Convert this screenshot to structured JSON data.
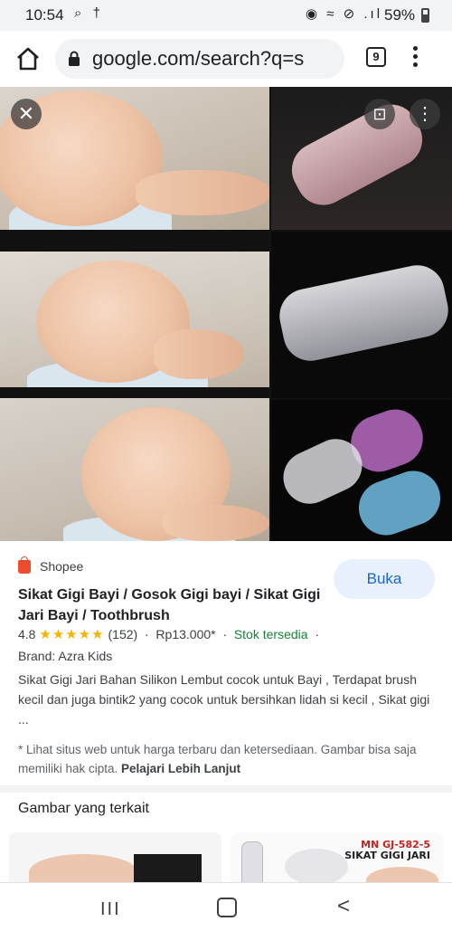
{
  "status_bar": {
    "time": "10:54",
    "left_icons": "⌕ †",
    "right_icons": "◉ ≈ ⊘ .ıl",
    "battery": "59%"
  },
  "browser": {
    "url": "google.com/search?q=s",
    "tab_count": "9"
  },
  "result": {
    "source": "Shopee",
    "open_button": "Buka",
    "title": "Sikat Gigi Bayi / Gosok Gigi bayi / Sikat Gigi Jari Bayi / Toothbrush",
    "rating": "4.8",
    "stars": "★★★★★",
    "review_count": "(152)",
    "separator": "·",
    "price": "Rp13.000*",
    "stock": "Stok tersedia",
    "brand": "Brand: Azra Kids",
    "description": "Sikat Gigi Jari Bahan Silikon Lembut cocok untuk Bayi , Terdapat brush kecil dan juga bintik2 yang cocok untuk bersihkan lidah si kecil , Sikat gigi ...",
    "note": "* Lihat situs web untuk harga terbaru dan ketersediaan. Gambar bisa saja memiliki hak cipta.",
    "learn_more": "Pelajari Lebih Lanjut"
  },
  "related": {
    "heading": "Gambar yang terkait",
    "card2_label_line1": "MN GJ-582-5",
    "card2_label_line2": "SIKAT GIGI JARI"
  },
  "nav": {
    "recent": "III",
    "back": "<"
  }
}
